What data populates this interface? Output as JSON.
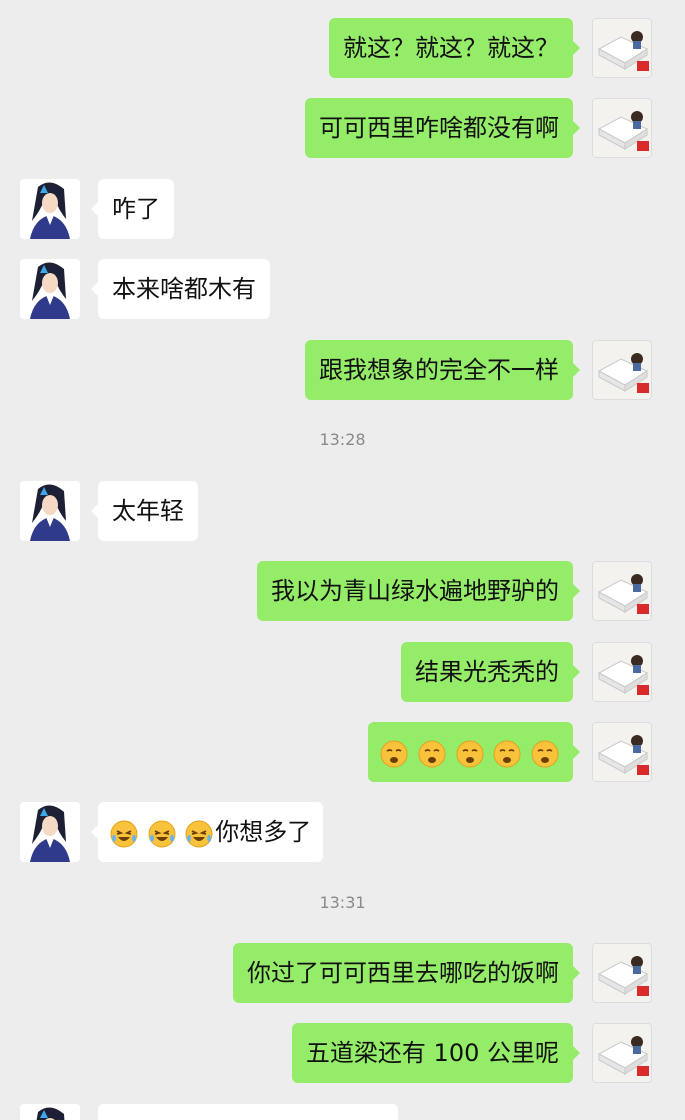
{
  "messages": [
    {
      "side": "me",
      "text": "就这？就这？就这？"
    },
    {
      "side": "me",
      "text": "可可西里咋啥都没有啊"
    },
    {
      "side": "them",
      "text": "咋了"
    },
    {
      "side": "them",
      "text": "本来啥都木有"
    },
    {
      "side": "me",
      "text": "跟我想象的完全不一样"
    },
    {
      "type": "time",
      "text": "13:28"
    },
    {
      "side": "them",
      "text": "太年轻"
    },
    {
      "side": "me",
      "text": "我以为青山绿水遍地野驴的"
    },
    {
      "side": "me",
      "text": "结果光秃秃的"
    },
    {
      "side": "me",
      "emoji": "sleepy-face-emoji",
      "emoji_count": 5
    },
    {
      "side": "them",
      "emoji": "laughing-tears-emoji",
      "emoji_count": 3,
      "text": "你想多了"
    },
    {
      "type": "time",
      "text": "13:31"
    },
    {
      "side": "me",
      "text": "你过了可可西里去哪吃的饭啊"
    },
    {
      "side": "me",
      "text": "五道梁还有 100 公里呢"
    },
    {
      "side": "them",
      "text": ""
    }
  ],
  "colors": {
    "background": "#ededed",
    "my_bubble": "#95ec69",
    "their_bubble": "#ffffff",
    "timestamp_text": "#8a8a8a"
  },
  "avatars": {
    "me": "bed-photo-avatar",
    "them": "anime-character-avatar"
  }
}
